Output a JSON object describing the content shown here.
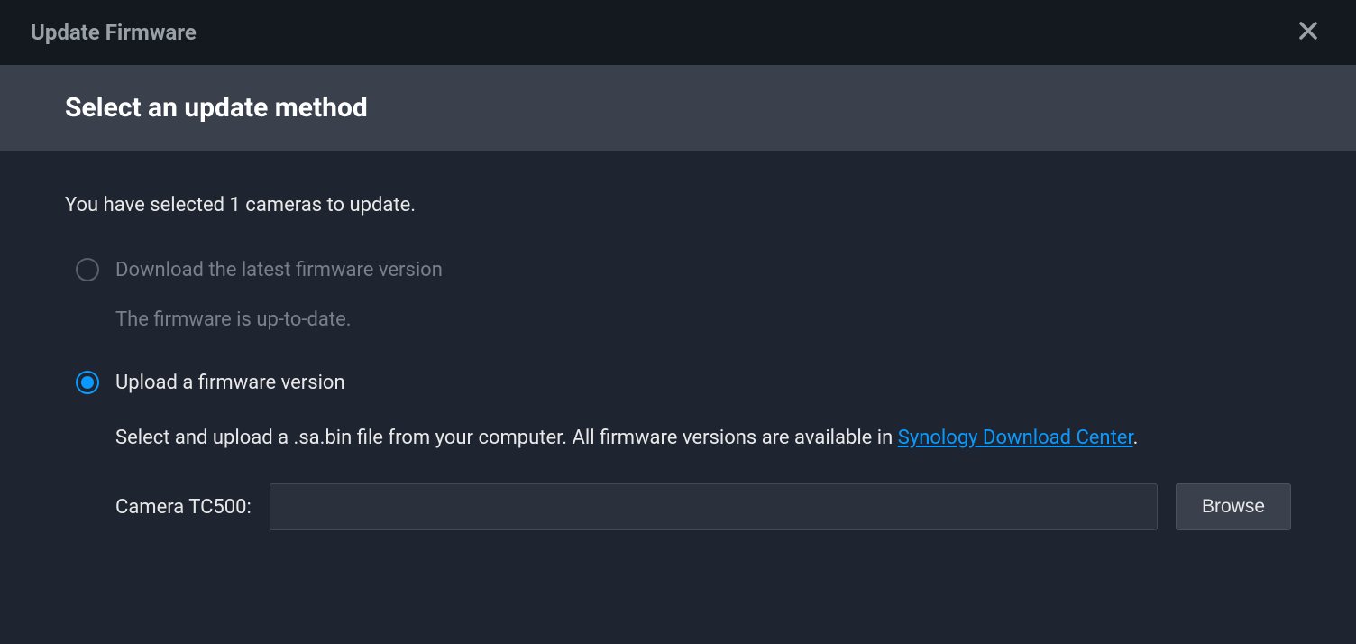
{
  "titlebar": {
    "title": "Update Firmware"
  },
  "header": {
    "heading": "Select an update method"
  },
  "content": {
    "intro": "You have selected 1 cameras to update.",
    "option_download": {
      "label": "Download the latest firmware version",
      "status": "The firmware is up-to-date."
    },
    "option_upload": {
      "label": "Upload a firmware version",
      "description_prefix": "Select and upload a .sa.bin file from your computer. All firmware versions are available in ",
      "link_text": "Synology Download Center",
      "description_suffix": "."
    },
    "file_row": {
      "camera_label": "Camera TC500:",
      "file_value": "",
      "browse_label": "Browse"
    }
  }
}
